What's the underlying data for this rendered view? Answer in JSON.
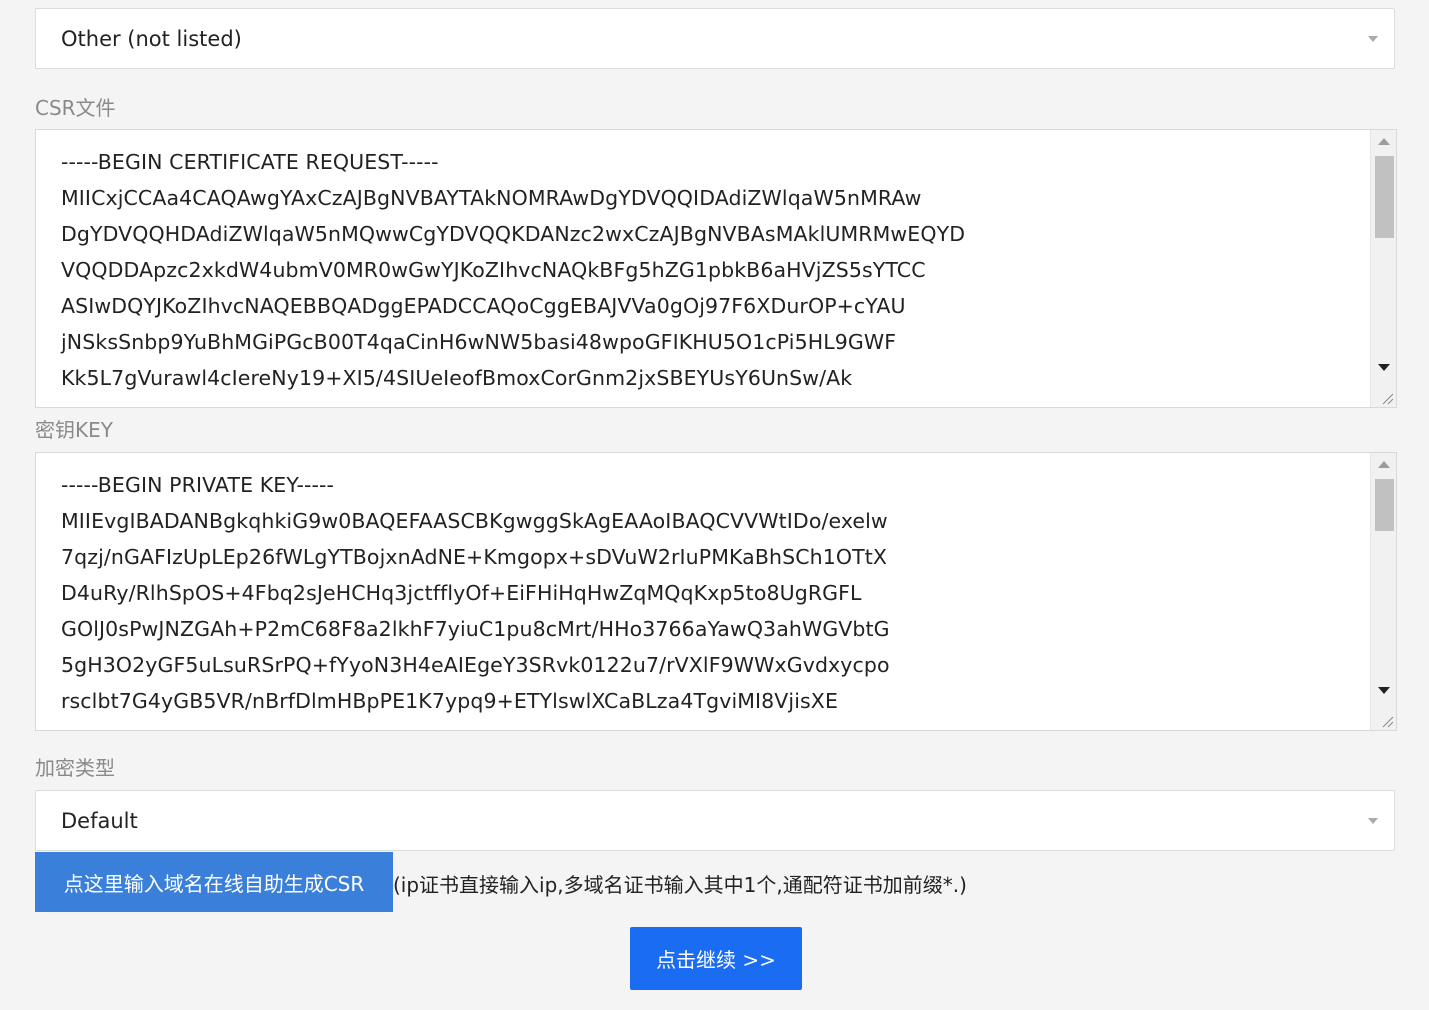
{
  "platform_select": {
    "value": "Other (not listed)"
  },
  "csr": {
    "label": "CSR文件",
    "lines": [
      "-----BEGIN CERTIFICATE REQUEST-----",
      "MIICxjCCAa4CAQAwgYAxCzAJBgNVBAYTAkNOMRAwDgYDVQQIDAdiZWlqaW5nMRAw",
      "DgYDVQQHDAdiZWlqaW5nMQwwCgYDVQQKDANzc2wxCzAJBgNVBAsMAklUMRMwEQYD",
      "VQQDDApzc2xkdW4ubmV0MR0wGwYJKoZIhvcNAQkBFg5hZG1pbkB6aHVjZS5sYTCC",
      "ASIwDQYJKoZIhvcNAQEBBQADggEPADCCAQoCggEBAJVVa0gOj97F6XDurOP+cYAU",
      "jNSksSnbp9YuBhMGiPGcB00T4qaCinH6wNW5basi48wpoGFIKHU5O1cPi5HL9GWF",
      "Kk5L7gVurawl4cIereNy19+XI5/4SIUeIeofBmoxCorGnm2jxSBEYUsY6UnSw/Ak"
    ]
  },
  "key": {
    "label": "密钥KEY",
    "lines": [
      "-----BEGIN PRIVATE KEY-----",
      "MIIEvgIBADANBgkqhkiG9w0BAQEFAASCBKgwggSkAgEAAoIBAQCVVWtIDo/exelw",
      "7qzj/nGAFIzUpLEp26fWLgYTBojxnAdNE+Kmgopx+sDVuW2rIuPMKaBhSCh1OTtX",
      "D4uRy/RlhSpOS+4Fbq2sJeHCHq3jctfflyOf+EiFHiHqHwZqMQqKxp5to8UgRGFL",
      "GOlJ0sPwJNZGAh+P2mC68F8a2lkhF7yiuC1pu8cMrt/HHo3766aYawQ3ahWGVbtG",
      "5gH3O2yGF5uLsuRSrPQ+fYyoN3H4eAIEgeY3SRvk0122u7/rVXlF9WWxGvdxycpo",
      "rsclbt7G4yGB5VR/nBrfDlmHBpPE1K7ypq9+ETYlswlXCaBLza4TgviMI8VjisXE"
    ]
  },
  "encryption": {
    "label": "加密类型",
    "value": "Default"
  },
  "generate_button": "点这里输入域名在线自助生成CSR",
  "hint": "(ip证书直接输入ip,多域名证书输入其中1个,通配符证书加前缀*.)",
  "continue_button": "点击继续 >>"
}
